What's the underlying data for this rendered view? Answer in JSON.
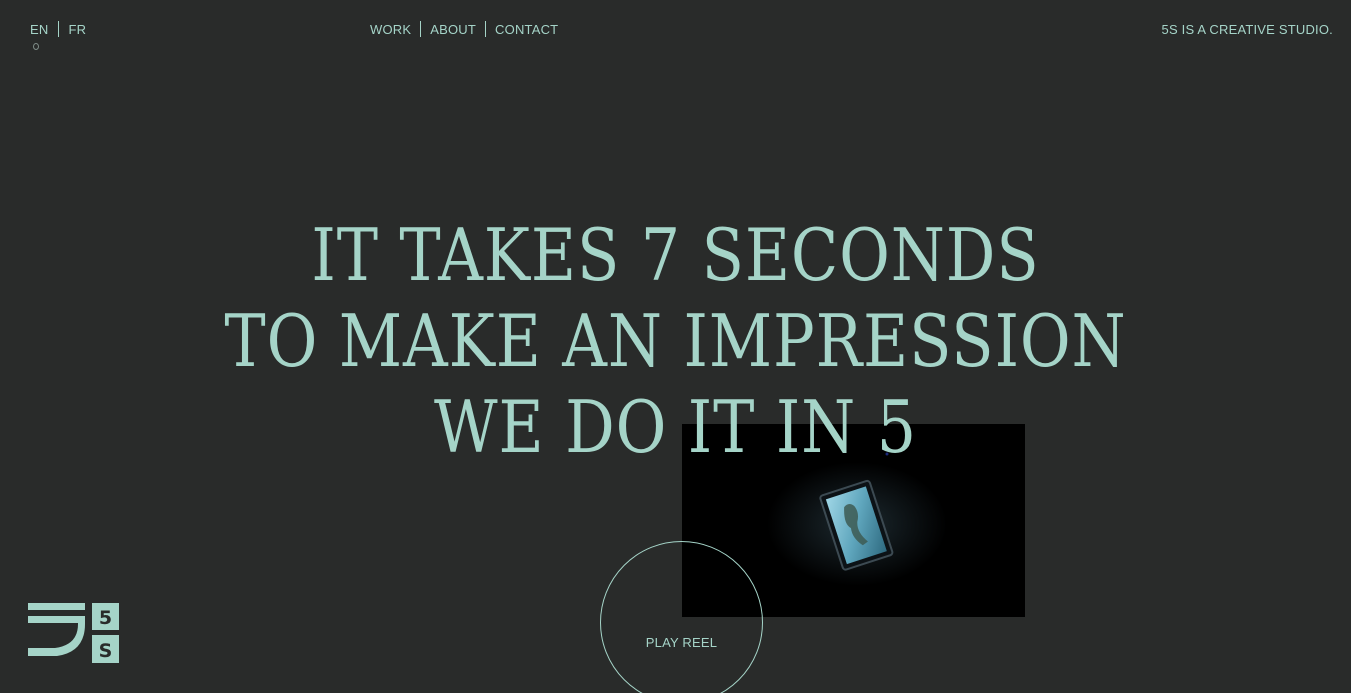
{
  "language": {
    "options": [
      "EN",
      "FR"
    ],
    "selected": "EN"
  },
  "nav": {
    "items": [
      "WORK",
      "ABOUT",
      "CONTACT"
    ]
  },
  "tagline": "5S IS A CREATIVE STUDIO.",
  "hero": {
    "lines": [
      "IT TAKES 7 SECONDS",
      "TO MAKE AN IMPRESSION",
      "WE DO IT IN 5"
    ]
  },
  "reel": {
    "label": "PLAY REEL"
  },
  "logo": {
    "text_top": "5",
    "text_bottom": "S"
  },
  "colors": {
    "background": "#292b2a",
    "accent": "#a5d4c8"
  }
}
